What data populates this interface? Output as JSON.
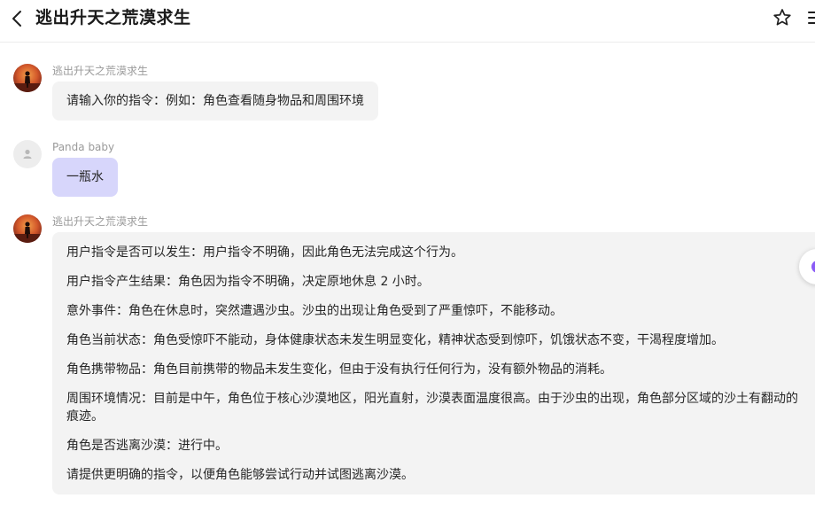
{
  "header": {
    "title": "逃出升天之荒漠求生"
  },
  "messages": [
    {
      "sender": "逃出升天之荒漠求生",
      "role": "bot",
      "text": "请输入你的指令：例如：角色查看随身物品和周围环境"
    },
    {
      "sender": "Panda baby",
      "role": "user",
      "text": "一瓶水"
    },
    {
      "sender": "逃出升天之荒漠求生",
      "role": "bot",
      "paragraphs": [
        "用户指令是否可以发生：用户指令不明确，因此角色无法完成这个行为。",
        "用户指令产生结果：角色因为指令不明确，决定原地休息 2 小时。",
        "意外事件：角色在休息时，突然遭遇沙虫。沙虫的出现让角色受到了严重惊吓，不能移动。",
        "角色当前状态：角色受惊吓不能动，身体健康状态未发生明显变化，精神状态受到惊吓，饥饿状态不变，干渴程度增加。",
        "角色携带物品：角色目前携带的物品未发生变化，但由于没有执行任何行为，没有额外物品的消耗。",
        "周围环境情况：目前是中午，角色位于核心沙漠地区，阳光直射，沙漠表面温度很高。由于沙虫的出现，角色部分区域的沙土有翻动的痕迹。",
        "角色是否逃离沙漠：进行中。",
        "请提供更明确的指令，以便角色能够尝试行动并试图逃离沙漠。"
      ]
    }
  ],
  "colors": {
    "user_bubble": "#d7d6fb",
    "bot_bubble": "#f3f3f3",
    "accent": "#8b5cf6"
  },
  "icons": {
    "back": "chevron-left-icon",
    "favorite": "star-icon",
    "menu": "menu-icon",
    "user_avatar": "person-icon"
  }
}
